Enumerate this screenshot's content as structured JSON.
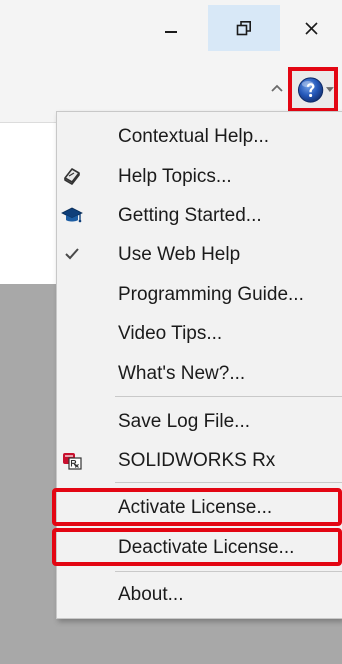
{
  "window": {
    "minimize_icon": "minimize-icon",
    "restore_icon": "restore-icon",
    "close_icon": "close-icon"
  },
  "ribbon": {
    "collapse_icon": "chevron-up-icon",
    "help_icon": "help-question-icon",
    "dropdown_icon": "caret-down-icon",
    "highlight_color": "#e30613"
  },
  "menu": {
    "items": [
      {
        "label": "Contextual Help...",
        "icon": ""
      },
      {
        "label": "Help Topics...",
        "icon": "help-book-icon"
      },
      {
        "label": "Getting Started...",
        "icon": "graduation-cap-icon"
      },
      {
        "label": "Use Web Help",
        "icon": "checkmark-icon"
      },
      {
        "label": "Programming Guide...",
        "icon": ""
      },
      {
        "label": "Video Tips...",
        "icon": ""
      },
      {
        "label": "What's New?...",
        "icon": ""
      },
      {
        "label": "Save Log File...",
        "icon": ""
      },
      {
        "label": "SOLIDWORKS Rx",
        "icon": "solidworks-rx-icon"
      },
      {
        "label": "Activate License...",
        "icon": "",
        "highlighted": true
      },
      {
        "label": "Deactivate License...",
        "icon": "",
        "highlighted": true
      },
      {
        "label": "About...",
        "icon": ""
      }
    ]
  }
}
